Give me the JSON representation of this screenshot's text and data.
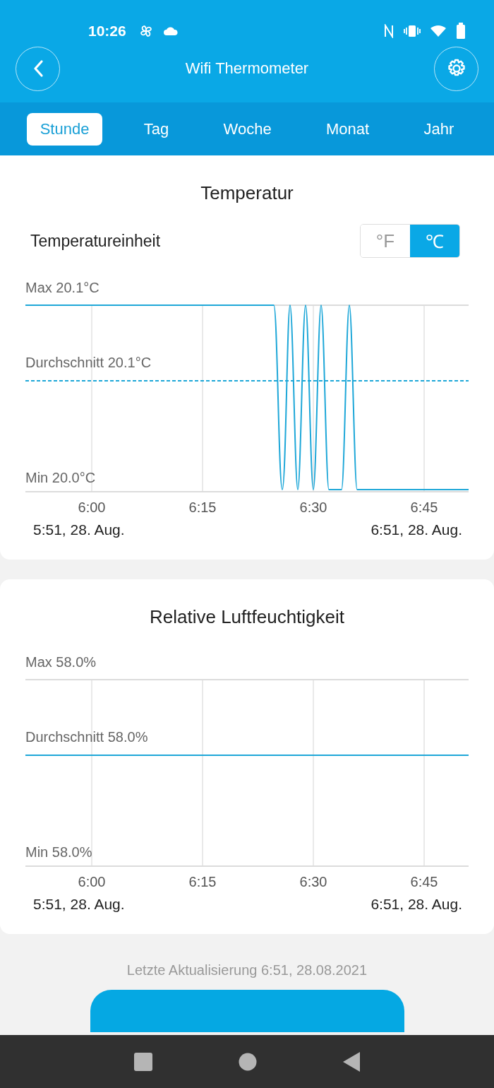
{
  "status_bar": {
    "time": "10:26"
  },
  "app_bar": {
    "title": "Wifi Thermometer"
  },
  "tabs": [
    {
      "label": "Stunde",
      "selected": true
    },
    {
      "label": "Tag",
      "selected": false
    },
    {
      "label": "Woche",
      "selected": false
    },
    {
      "label": "Monat",
      "selected": false
    },
    {
      "label": "Jahr",
      "selected": false
    }
  ],
  "cards": [
    {
      "title": "Temperatur",
      "kind": "wave",
      "unit_label": "Temperatureinheit",
      "units": [
        {
          "label": "°F",
          "selected": false
        },
        {
          "label": "℃",
          "selected": true
        }
      ],
      "max_label": "Max 20.1°C",
      "average_label": "Durchschnitt 20.1°C",
      "min_label": "Min 20.0°C",
      "time_ticks": [
        "6:00",
        "6:15",
        "6:30",
        "6:45"
      ],
      "range_start": "5:51,  28. Aug.",
      "range_end": "6:51,  28. Aug."
    },
    {
      "title": "Relative Luftfeuchtigkeit",
      "kind": "flat",
      "max_label": "Max 58.0%",
      "average_label": "Durchschnitt 58.0%",
      "min_label": "Min 58.0%",
      "time_ticks": [
        "6:00",
        "6:15",
        "6:30",
        "6:45"
      ],
      "range_start": "5:51,  28. Aug.",
      "range_end": "6:51,  28. Aug."
    }
  ],
  "footer": {
    "last_update": "Letzte Aktualisierung 6:51,  28.08.2021"
  }
}
